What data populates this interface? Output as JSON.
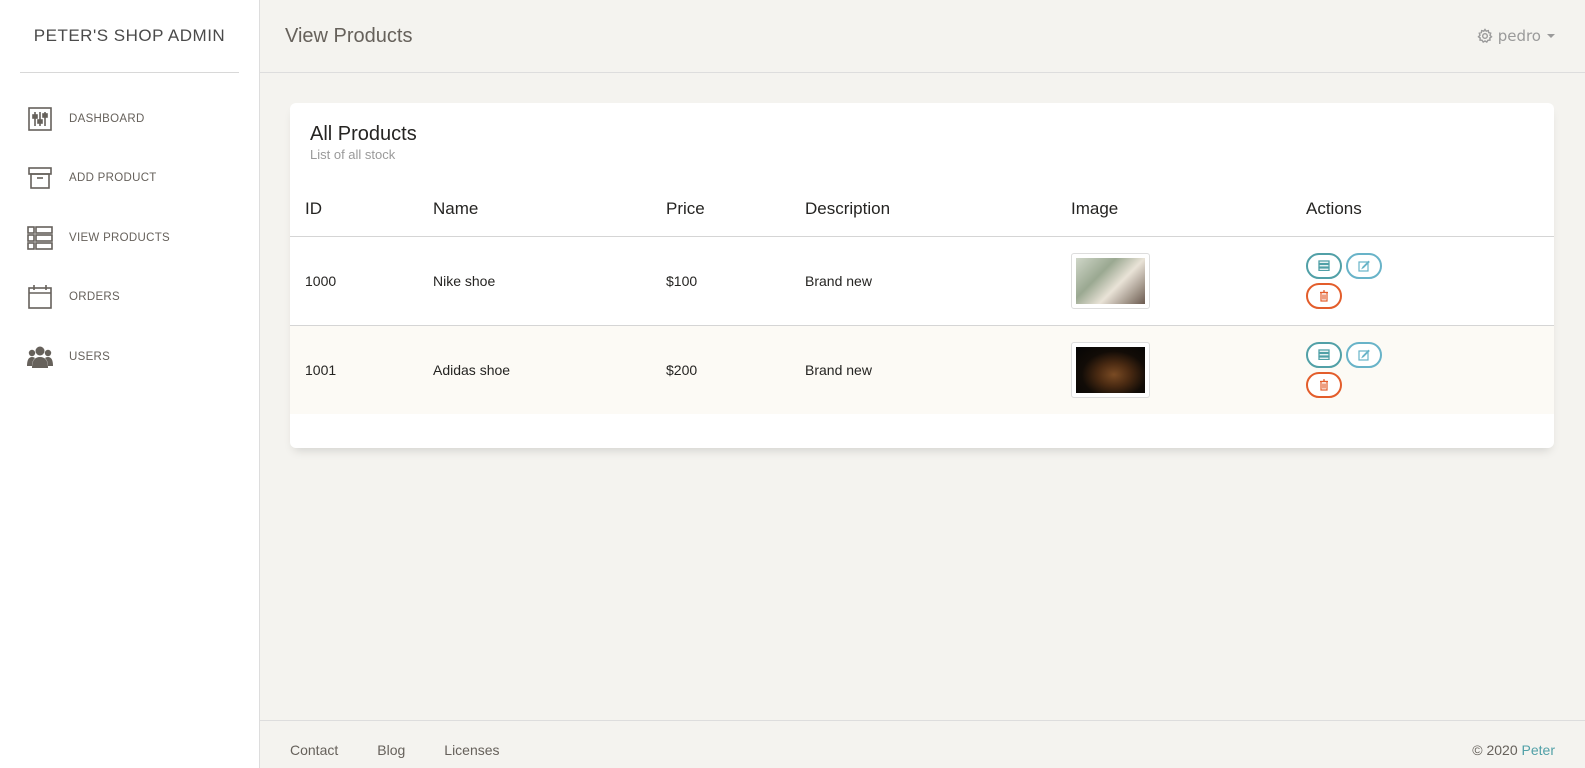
{
  "brand": "PETER'S SHOP ADMIN",
  "sidebar": {
    "items": [
      {
        "label": "DASHBOARD",
        "icon": "dashboard-icon"
      },
      {
        "label": "ADD PRODUCT",
        "icon": "archive-box-icon"
      },
      {
        "label": "VIEW PRODUCTS",
        "icon": "list-icon"
      },
      {
        "label": "ORDERS",
        "icon": "calendar-icon"
      },
      {
        "label": "USERS",
        "icon": "users-icon"
      }
    ]
  },
  "header": {
    "title": "View Products",
    "user": "pedro"
  },
  "card": {
    "title": "All Products",
    "subtitle": "List of all stock",
    "columns": [
      "ID",
      "Name",
      "Price",
      "Description",
      "Image",
      "Actions"
    ],
    "rows": [
      {
        "id": "1000",
        "name": "Nike shoe",
        "price": "$100",
        "description": "Brand new",
        "image": "nike-shoe-image"
      },
      {
        "id": "1001",
        "name": "Adidas shoe",
        "price": "$200",
        "description": "Brand new",
        "image": "adidas-shoe-image"
      }
    ]
  },
  "footer": {
    "links": [
      "Contact",
      "Blog",
      "Licenses"
    ],
    "copyright": "© 2020",
    "author": "Peter"
  },
  "colors": {
    "accent": "#51a0a7",
    "danger": "#e35d2b",
    "info": "#68b3c8",
    "background": "#f4f3ef"
  }
}
